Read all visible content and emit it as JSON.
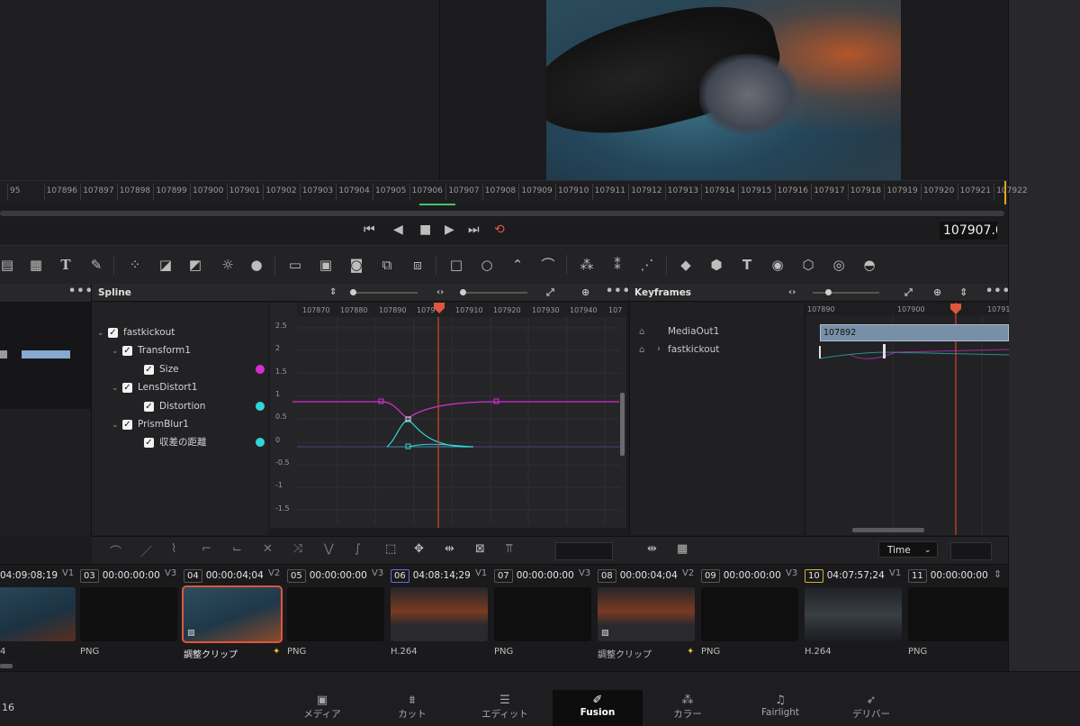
{
  "ruler": {
    "ticks": [
      "95",
      "107896",
      "107897",
      "107898",
      "107899",
      "107900",
      "107901",
      "107902",
      "107903",
      "107904",
      "107905",
      "107906",
      "107907",
      "107908",
      "107909",
      "107910",
      "107911",
      "107912",
      "107913",
      "107914",
      "107915",
      "107916",
      "107917",
      "107918",
      "107919",
      "107920",
      "107921",
      "107922"
    ]
  },
  "transport": {
    "timecode": "107907.0"
  },
  "spline": {
    "title": "Spline",
    "ruler": [
      "107870",
      "107880",
      "107890",
      "1079",
      "107910",
      "107920",
      "107930",
      "107940",
      "107"
    ],
    "yaxis": [
      "2.5",
      "2",
      "1.5",
      "1",
      "0.5",
      "0",
      "-0.5",
      "-1",
      "-1.5"
    ],
    "tree": [
      {
        "label": "fastkickout",
        "level": 0
      },
      {
        "label": "Transform1",
        "level": 1
      },
      {
        "label": "Size",
        "level": 2
      },
      {
        "label": "LensDistort1",
        "level": 1
      },
      {
        "label": "Distortion",
        "level": 2
      },
      {
        "label": "PrismBlur1",
        "level": 1
      },
      {
        "label": "収差の距離",
        "level": 2
      }
    ],
    "colors": {
      "size": "#d42fd4",
      "distortion": "#2fd7d7",
      "aberration": "#2fd7d7"
    }
  },
  "keyframes": {
    "title": "Keyframes",
    "ruler": [
      "107890",
      "107900",
      "10791"
    ],
    "tree": [
      "MediaOut1",
      "fastkickout"
    ],
    "clip_label": "107892",
    "time_label": "Time"
  },
  "clips": [
    {
      "tc": "04:09:08;19",
      "track": "V1",
      "codec": "",
      "num": ""
    },
    {
      "num": "03",
      "tc": "00:00:00:00",
      "track": "V3",
      "codec": "PNG"
    },
    {
      "num": "04",
      "tc": "00:00:04;04",
      "track": "V2",
      "codec": "調整クリップ"
    },
    {
      "num": "05",
      "tc": "00:00:00:00",
      "track": "V3",
      "codec": "PNG"
    },
    {
      "num": "06",
      "tc": "04:08:14;29",
      "track": "V1",
      "codec": "H.264"
    },
    {
      "num": "07",
      "tc": "00:00:00:00",
      "track": "V3",
      "codec": "PNG"
    },
    {
      "num": "08",
      "tc": "00:00:04;04",
      "track": "V2",
      "codec": "調整クリップ"
    },
    {
      "num": "09",
      "tc": "00:00:00:00",
      "track": "V3",
      "codec": "PNG"
    },
    {
      "num": "10",
      "tc": "04:07:57;24",
      "track": "V1",
      "codec": "H.264"
    },
    {
      "num": "11",
      "tc": "00:00:00:00",
      "track": "",
      "codec": "PNG"
    }
  ],
  "left_label": "16",
  "first_clip_label": "4",
  "pages": [
    {
      "label": "メディア",
      "icon": "media-icon"
    },
    {
      "label": "カット",
      "icon": "cut-icon"
    },
    {
      "label": "エディット",
      "icon": "edit-icon"
    },
    {
      "label": "Fusion",
      "icon": "fusion-icon"
    },
    {
      "label": "カラー",
      "icon": "color-icon"
    },
    {
      "label": "Fairlight",
      "icon": "fairlight-icon"
    },
    {
      "label": "デリバー",
      "icon": "deliver-icon"
    }
  ]
}
